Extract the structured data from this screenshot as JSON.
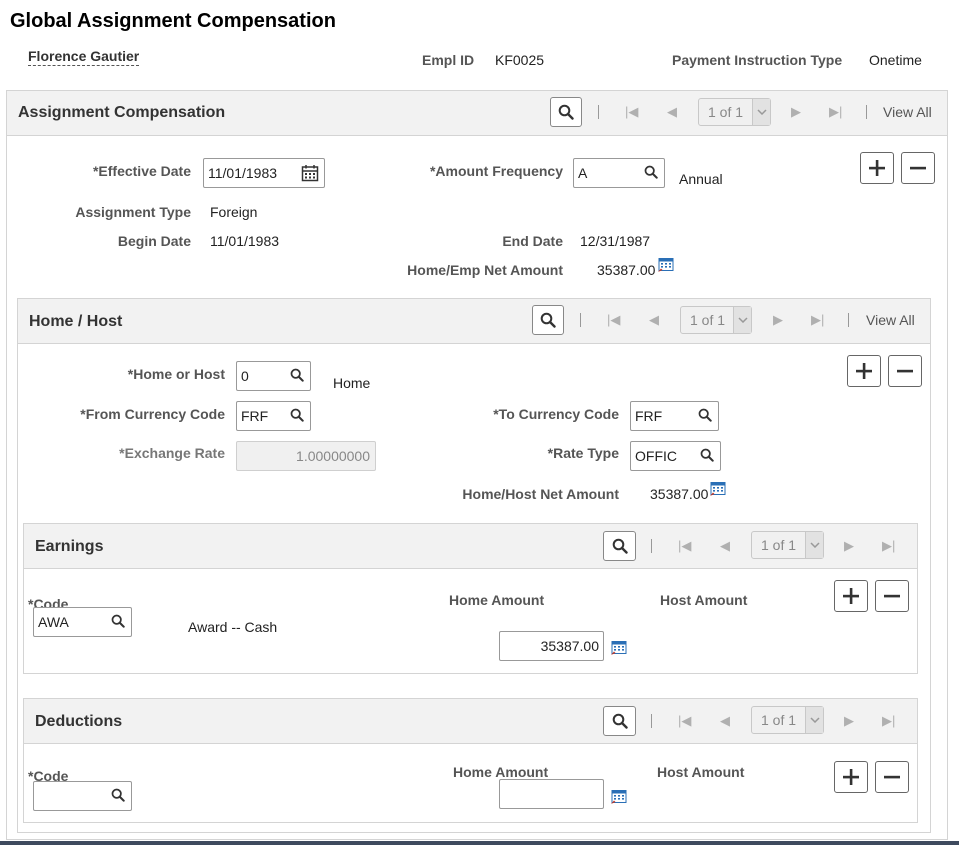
{
  "page": {
    "title": "Global Assignment Compensation",
    "employee_name": "Florence Gautier",
    "empl_id_label": "Empl ID",
    "empl_id": "KF0025",
    "payment_type_label": "Payment Instruction Type",
    "payment_type": "Onetime"
  },
  "assignment": {
    "title": "Assignment Compensation",
    "pager": "1 of 1",
    "view_all": "View All",
    "effective_date_label": "*Effective Date",
    "effective_date": "11/01/1983",
    "amount_frequency_label": "*Amount Frequency",
    "amount_frequency": "A",
    "amount_frequency_desc": "Annual",
    "assignment_type_label": "Assignment Type",
    "assignment_type": "Foreign",
    "begin_date_label": "Begin Date",
    "begin_date": "11/01/1983",
    "end_date_label": "End Date",
    "end_date": "12/31/1987",
    "net_amount_label": "Home/Emp Net Amount",
    "net_amount": "35387.00"
  },
  "home_host": {
    "title": "Home / Host",
    "pager": "1 of 1",
    "view_all": "View All",
    "home_or_host_label": "*Home or Host",
    "home_or_host": "0",
    "home_or_host_desc": "Home",
    "from_currency_label": "*From Currency Code",
    "from_currency": "FRF",
    "to_currency_label": "*To Currency Code",
    "to_currency": "FRF",
    "exchange_rate_label": "*Exchange Rate",
    "exchange_rate": "1.00000000",
    "rate_type_label": "*Rate Type",
    "rate_type": "OFFIC",
    "net_amount_label": "Home/Host Net Amount",
    "net_amount": "35387.00"
  },
  "earnings": {
    "title": "Earnings",
    "pager": "1 of 1",
    "code_label": "*Code",
    "code": "AWA",
    "code_desc": "Award -- Cash",
    "home_amount_label": "Home Amount",
    "host_amount_label": "Host Amount",
    "home_amount": "35387.00"
  },
  "deductions": {
    "title": "Deductions",
    "pager": "1 of 1",
    "code_label": "*Code",
    "code": "",
    "home_amount_label": "Home Amount",
    "host_amount_label": "Host Amount",
    "home_amount": ""
  },
  "icons": [
    "search-icon",
    "calendar-icon",
    "first-icon",
    "previous-icon",
    "next-icon",
    "last-icon",
    "chevron-down-icon",
    "plus-icon",
    "minus-icon",
    "calculator-icon"
  ],
  "colors": {
    "panel_header": "#f2f2f2",
    "border": "#d4d4d4",
    "calc_blue": "#2a6fb6"
  }
}
